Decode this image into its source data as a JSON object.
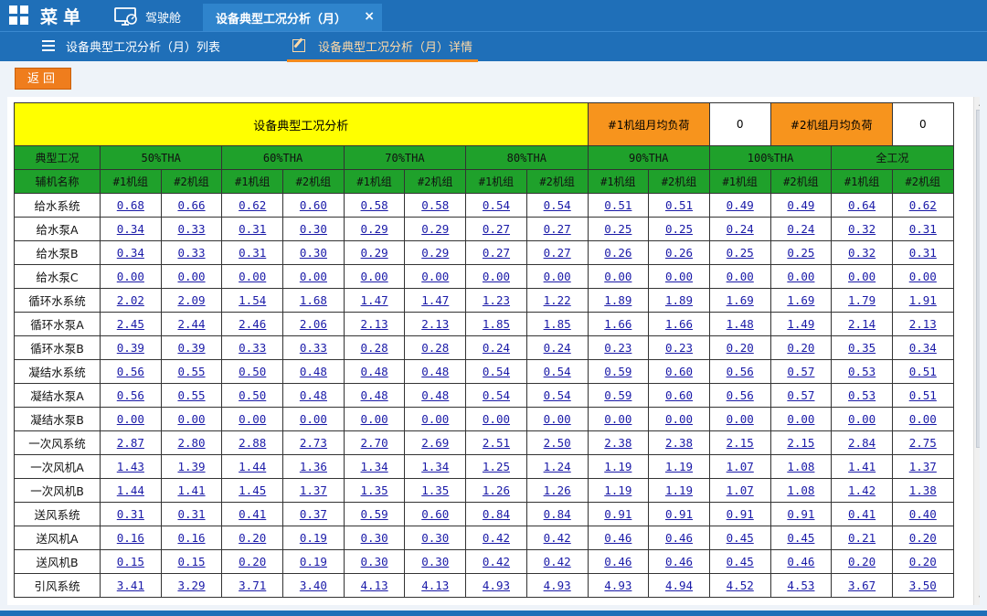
{
  "topbar": {
    "menu_label": "菜单",
    "cockpit_label": "驾驶舱",
    "active_tab": "设备典型工况分析（月）",
    "close_symbol": "×"
  },
  "subbar": {
    "list_tab": "设备典型工况分析（月）列表",
    "detail_tab": "设备典型工况分析（月）详情"
  },
  "return_label": "返回",
  "table": {
    "title": "设备典型工况分析",
    "unit1_load_label": "#1机组月均负荷",
    "unit1_load_value": "0",
    "unit2_load_label": "#2机组月均负荷",
    "unit2_load_value": "0",
    "condition_header": "典型工况",
    "name_header": "辅机名称",
    "conditions": [
      "50%THA",
      "60%THA",
      "70%THA",
      "80%THA",
      "90%THA",
      "100%THA",
      "全工况"
    ],
    "unit_labels": [
      "#1机组",
      "#2机组"
    ],
    "rows": [
      {
        "name": "给水系统",
        "values": [
          "0.68",
          "0.66",
          "0.62",
          "0.60",
          "0.58",
          "0.58",
          "0.54",
          "0.54",
          "0.51",
          "0.51",
          "0.49",
          "0.49",
          "0.64",
          "0.62"
        ]
      },
      {
        "name": "给水泵A",
        "values": [
          "0.34",
          "0.33",
          "0.31",
          "0.30",
          "0.29",
          "0.29",
          "0.27",
          "0.27",
          "0.25",
          "0.25",
          "0.24",
          "0.24",
          "0.32",
          "0.31"
        ]
      },
      {
        "name": "给水泵B",
        "values": [
          "0.34",
          "0.33",
          "0.31",
          "0.30",
          "0.29",
          "0.29",
          "0.27",
          "0.27",
          "0.26",
          "0.26",
          "0.25",
          "0.25",
          "0.32",
          "0.31"
        ]
      },
      {
        "name": "给水泵C",
        "values": [
          "0.00",
          "0.00",
          "0.00",
          "0.00",
          "0.00",
          "0.00",
          "0.00",
          "0.00",
          "0.00",
          "0.00",
          "0.00",
          "0.00",
          "0.00",
          "0.00"
        ]
      },
      {
        "name": "循环水系统",
        "values": [
          "2.02",
          "2.09",
          "1.54",
          "1.68",
          "1.47",
          "1.47",
          "1.23",
          "1.22",
          "1.89",
          "1.89",
          "1.69",
          "1.69",
          "1.79",
          "1.91"
        ]
      },
      {
        "name": "循环水泵A",
        "values": [
          "2.45",
          "2.44",
          "2.46",
          "2.06",
          "2.13",
          "2.13",
          "1.85",
          "1.85",
          "1.66",
          "1.66",
          "1.48",
          "1.49",
          "2.14",
          "2.13"
        ]
      },
      {
        "name": "循环水泵B",
        "values": [
          "0.39",
          "0.39",
          "0.33",
          "0.33",
          "0.28",
          "0.28",
          "0.24",
          "0.24",
          "0.23",
          "0.23",
          "0.20",
          "0.20",
          "0.35",
          "0.34"
        ]
      },
      {
        "name": "凝结水系统",
        "values": [
          "0.56",
          "0.55",
          "0.50",
          "0.48",
          "0.48",
          "0.48",
          "0.54",
          "0.54",
          "0.59",
          "0.60",
          "0.56",
          "0.57",
          "0.53",
          "0.51"
        ]
      },
      {
        "name": "凝结水泵A",
        "values": [
          "0.56",
          "0.55",
          "0.50",
          "0.48",
          "0.48",
          "0.48",
          "0.54",
          "0.54",
          "0.59",
          "0.60",
          "0.56",
          "0.57",
          "0.53",
          "0.51"
        ]
      },
      {
        "name": "凝结水泵B",
        "values": [
          "0.00",
          "0.00",
          "0.00",
          "0.00",
          "0.00",
          "0.00",
          "0.00",
          "0.00",
          "0.00",
          "0.00",
          "0.00",
          "0.00",
          "0.00",
          "0.00"
        ]
      },
      {
        "name": "一次风系统",
        "values": [
          "2.87",
          "2.80",
          "2.88",
          "2.73",
          "2.70",
          "2.69",
          "2.51",
          "2.50",
          "2.38",
          "2.38",
          "2.15",
          "2.15",
          "2.84",
          "2.75"
        ]
      },
      {
        "name": "一次风机A",
        "values": [
          "1.43",
          "1.39",
          "1.44",
          "1.36",
          "1.34",
          "1.34",
          "1.25",
          "1.24",
          "1.19",
          "1.19",
          "1.07",
          "1.08",
          "1.41",
          "1.37"
        ]
      },
      {
        "name": "一次风机B",
        "values": [
          "1.44",
          "1.41",
          "1.45",
          "1.37",
          "1.35",
          "1.35",
          "1.26",
          "1.26",
          "1.19",
          "1.19",
          "1.07",
          "1.08",
          "1.42",
          "1.38"
        ]
      },
      {
        "name": "送风系统",
        "values": [
          "0.31",
          "0.31",
          "0.41",
          "0.37",
          "0.59",
          "0.60",
          "0.84",
          "0.84",
          "0.91",
          "0.91",
          "0.91",
          "0.91",
          "0.41",
          "0.40"
        ]
      },
      {
        "name": "送风机A",
        "values": [
          "0.16",
          "0.16",
          "0.20",
          "0.19",
          "0.30",
          "0.30",
          "0.42",
          "0.42",
          "0.46",
          "0.46",
          "0.45",
          "0.45",
          "0.21",
          "0.20"
        ]
      },
      {
        "name": "送风机B",
        "values": [
          "0.15",
          "0.15",
          "0.20",
          "0.19",
          "0.30",
          "0.30",
          "0.42",
          "0.42",
          "0.46",
          "0.46",
          "0.45",
          "0.46",
          "0.20",
          "0.20"
        ]
      },
      {
        "name": "引风系统",
        "values": [
          "3.41",
          "3.29",
          "3.71",
          "3.40",
          "4.13",
          "4.13",
          "4.93",
          "4.93",
          "4.93",
          "4.94",
          "4.52",
          "4.53",
          "3.67",
          "3.50"
        ]
      }
    ]
  },
  "colors": {
    "topbar": "#1f6fb8",
    "active_tab": "#2f84cc",
    "accent_orange": "#f7941d",
    "header_yellow": "#ffff00",
    "header_green": "#1fa12b",
    "link_blue": "#1a1aa8"
  },
  "icons": {
    "menu": "grid-icon",
    "cockpit": "monitor-gauge-icon",
    "list_tab": "list-icon",
    "detail_tab": "edit-icon"
  }
}
